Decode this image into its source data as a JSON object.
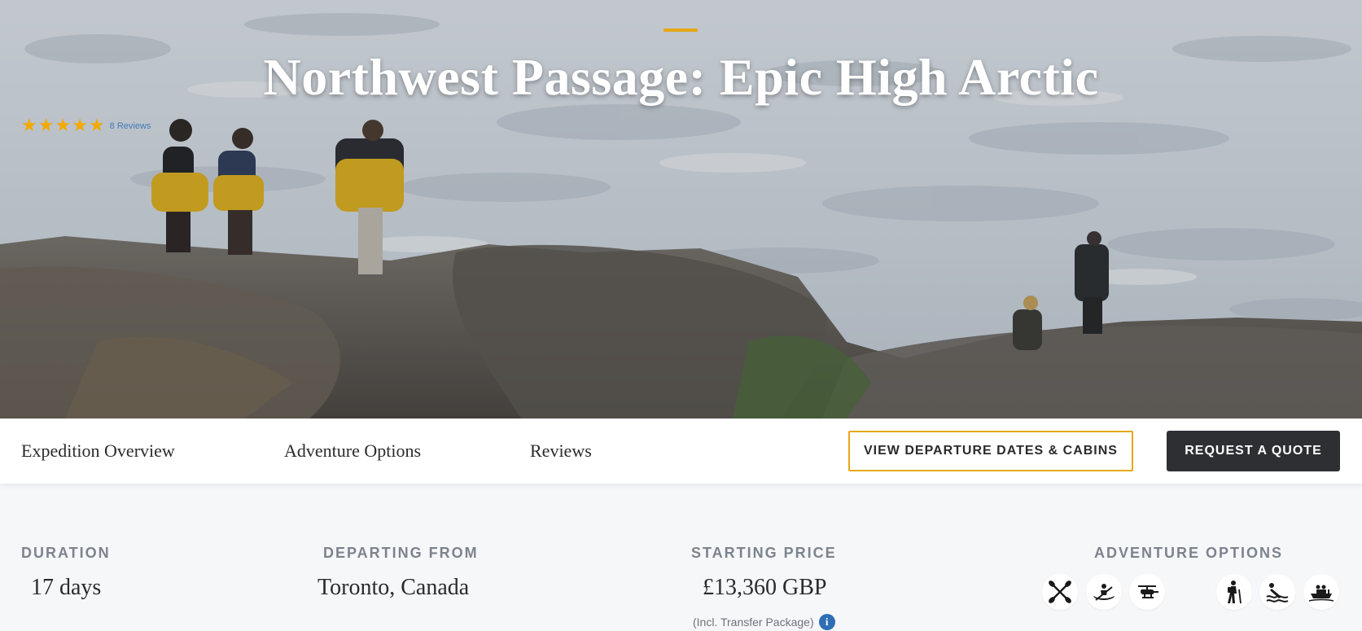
{
  "hero": {
    "title": "Northwest Passage: Epic High Arctic",
    "rating": {
      "stars": 5,
      "max": 5,
      "reviews_label": "8 Reviews"
    },
    "colors": {
      "accent": "#e6a817",
      "star": "#f2a900"
    }
  },
  "nav": {
    "links": [
      "Expedition Overview",
      "Adventure Options",
      "Reviews"
    ],
    "departures_button": "VIEW DEPARTURE DATES & CABINS",
    "quote_button": "REQUEST A QUOTE"
  },
  "info": {
    "duration": {
      "label": "DURATION",
      "value": "17 days"
    },
    "departing": {
      "label": "DEPARTING FROM",
      "value": "Toronto, Canada"
    },
    "price": {
      "label": "STARTING PRICE",
      "value": "£13,360 GBP",
      "note": "(Incl. Transfer Package)",
      "info_glyph": "i"
    },
    "adventure": {
      "label": "ADVENTURE OPTIONS",
      "icons": [
        "kayak-paddles-icon",
        "kayaking-icon",
        "helicopter-icon",
        "hiking-icon",
        "snorkeling-icon",
        "zodiac-boat-icon"
      ]
    }
  }
}
